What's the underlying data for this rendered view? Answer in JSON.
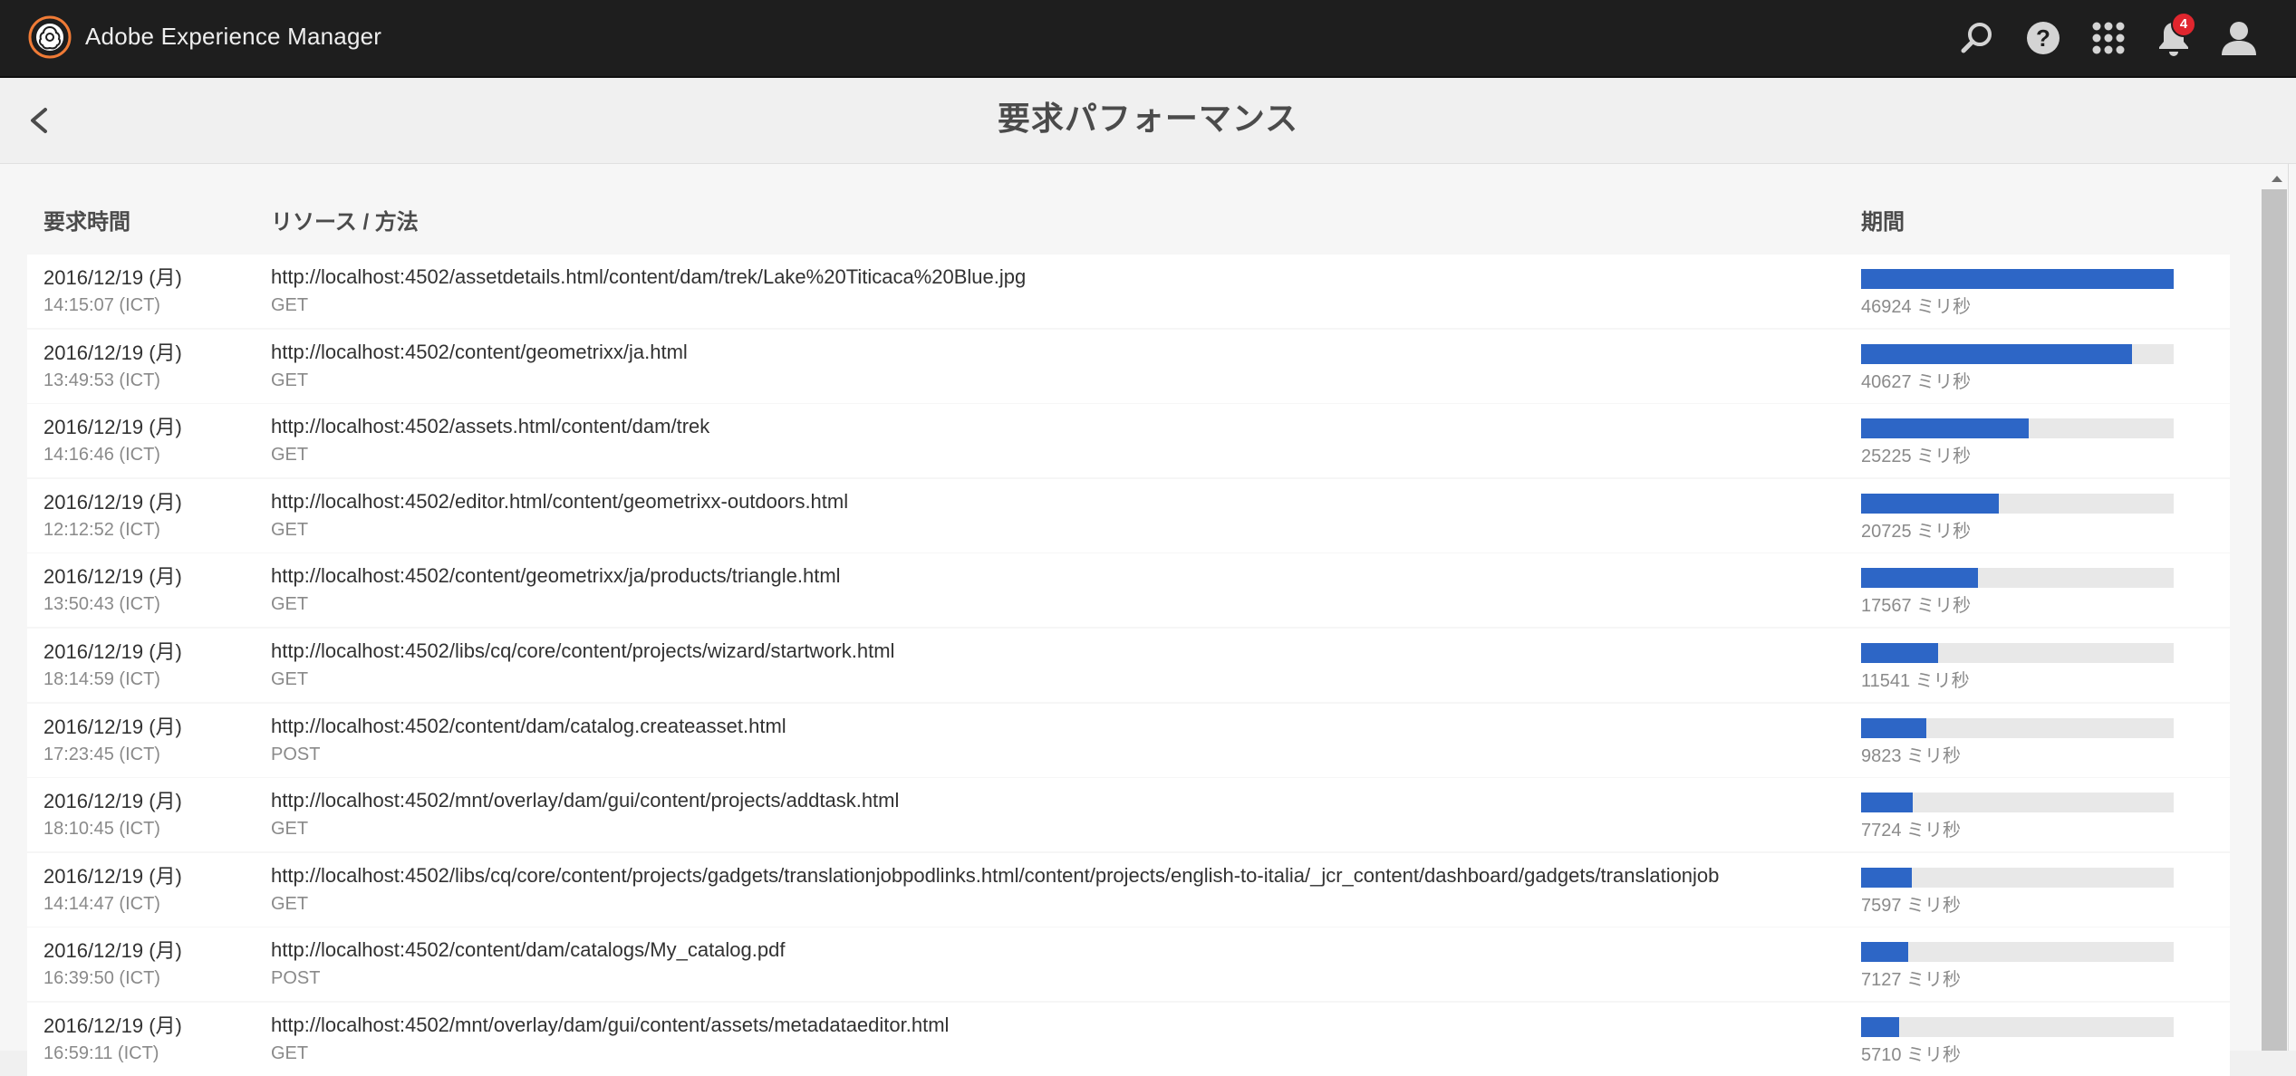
{
  "app": {
    "title": "Adobe Experience Manager",
    "notification_count": "4",
    "icons": [
      "adobe-logo-icon",
      "search-icon",
      "help-icon",
      "solutions-grid-icon",
      "bell-icon",
      "user-icon"
    ]
  },
  "colors": {
    "topbar": "#1e1e1e",
    "accent_orange": "#f07b36",
    "bar_fill": "#2d66c6",
    "bar_track": "#e8e8e8",
    "badge": "#e0262e"
  },
  "header": {
    "title": "要求パフォーマンス"
  },
  "columns": {
    "time": "要求時間",
    "resource": "リソース / 方法",
    "duration": "期間"
  },
  "rows": [
    {
      "date": "2016/12/19 (月)",
      "time": "14:15:07 (ICT)",
      "url": "http://localhost:4502/assetdetails.html/content/dam/trek/Lake%20Titicaca%20Blue.jpg",
      "method": "GET",
      "duration": "46924 ミリ秒",
      "ms": 46924
    },
    {
      "date": "2016/12/19 (月)",
      "time": "13:49:53 (ICT)",
      "url": "http://localhost:4502/content/geometrixx/ja.html",
      "method": "GET",
      "duration": "40627 ミリ秒",
      "ms": 40627
    },
    {
      "date": "2016/12/19 (月)",
      "time": "14:16:46 (ICT)",
      "url": "http://localhost:4502/assets.html/content/dam/trek",
      "method": "GET",
      "duration": "25225 ミリ秒",
      "ms": 25225
    },
    {
      "date": "2016/12/19 (月)",
      "time": "12:12:52 (ICT)",
      "url": "http://localhost:4502/editor.html/content/geometrixx-outdoors.html",
      "method": "GET",
      "duration": "20725 ミリ秒",
      "ms": 20725
    },
    {
      "date": "2016/12/19 (月)",
      "time": "13:50:43 (ICT)",
      "url": "http://localhost:4502/content/geometrixx/ja/products/triangle.html",
      "method": "GET",
      "duration": "17567 ミリ秒",
      "ms": 17567
    },
    {
      "date": "2016/12/19 (月)",
      "time": "18:14:59 (ICT)",
      "url": "http://localhost:4502/libs/cq/core/content/projects/wizard/startwork.html",
      "method": "GET",
      "duration": "11541 ミリ秒",
      "ms": 11541
    },
    {
      "date": "2016/12/19 (月)",
      "time": "17:23:45 (ICT)",
      "url": "http://localhost:4502/content/dam/catalog.createasset.html",
      "method": "POST",
      "duration": "9823 ミリ秒",
      "ms": 9823
    },
    {
      "date": "2016/12/19 (月)",
      "time": "18:10:45 (ICT)",
      "url": "http://localhost:4502/mnt/overlay/dam/gui/content/projects/addtask.html",
      "method": "GET",
      "duration": "7724 ミリ秒",
      "ms": 7724
    },
    {
      "date": "2016/12/19 (月)",
      "time": "14:14:47 (ICT)",
      "url": "http://localhost:4502/libs/cq/core/content/projects/gadgets/translationjobpodlinks.html/content/projects/english-to-italia/_jcr_content/dashboard/gadgets/translationjob",
      "method": "GET",
      "duration": "7597 ミリ秒",
      "ms": 7597
    },
    {
      "date": "2016/12/19 (月)",
      "time": "16:39:50 (ICT)",
      "url": "http://localhost:4502/content/dam/catalogs/My_catalog.pdf",
      "method": "POST",
      "duration": "7127 ミリ秒",
      "ms": 7127
    },
    {
      "date": "2016/12/19 (月)",
      "time": "16:59:11 (ICT)",
      "url": "http://localhost:4502/mnt/overlay/dam/gui/content/assets/metadataeditor.html",
      "method": "GET",
      "duration": "5710 ミリ秒",
      "ms": 5710
    }
  ]
}
